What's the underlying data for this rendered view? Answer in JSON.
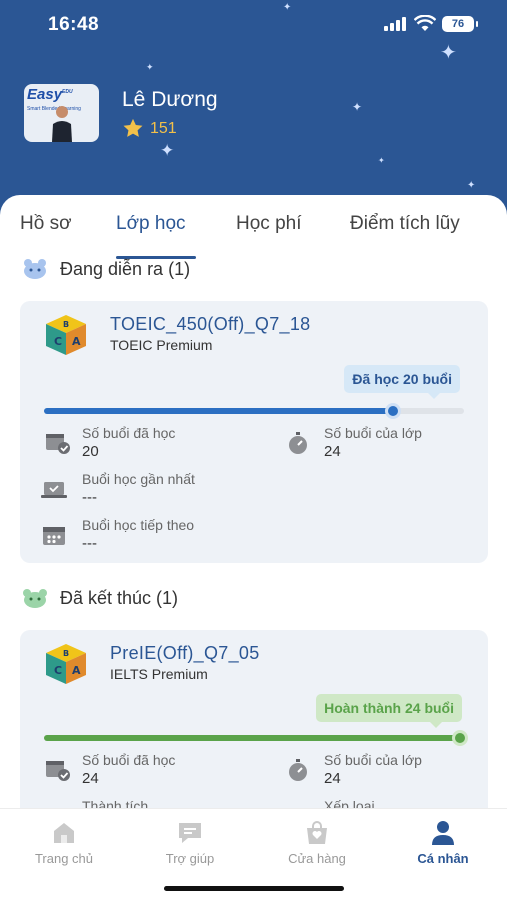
{
  "status_bar": {
    "time": "16:48",
    "battery": "76"
  },
  "profile": {
    "name": "Lê Dương",
    "points": "151",
    "avatar_logo": "Easy",
    "avatar_logo_sup": "EDU",
    "avatar_tagline": "Smart Blended Learning"
  },
  "tabs": [
    {
      "label": "Hồ sơ"
    },
    {
      "label": "Lớp học"
    },
    {
      "label": "Học phí"
    },
    {
      "label": "Điểm tích lũy"
    }
  ],
  "ongoing": {
    "title": "Đang diễn ra (1)",
    "course": {
      "name": "TOEIC_450(Off)_Q7_18",
      "type": "TOEIC Premium",
      "progress_label": "Đã học 20 buổi",
      "progress": 0.83,
      "stats": {
        "attended_label": "Số buổi đã học",
        "attended_value": "20",
        "total_label": "Số buổi của lớp",
        "total_value": "24",
        "last_label": "Buổi học gần nhất",
        "last_value": "---",
        "next_label": "Buổi học tiếp theo",
        "next_value": "---"
      }
    }
  },
  "finished": {
    "title": "Đã kết thúc (1)",
    "course": {
      "name": "PreIE(Off)_Q7_05",
      "type": "IELTS Premium",
      "progress_label": "Hoàn thành 24 buổi",
      "progress": 1.0,
      "stats": {
        "attended_label": "Số buổi đã học",
        "attended_value": "24",
        "total_label": "Số buổi của lớp",
        "total_value": "24",
        "achievement_label": "Thành tích",
        "rank_label": "Xếp loại"
      }
    }
  },
  "bottom_nav": [
    {
      "label": "Trang chủ"
    },
    {
      "label": "Trợ giúp"
    },
    {
      "label": "Cửa hàng"
    },
    {
      "label": "Cá nhân"
    }
  ],
  "colors": {
    "header": "#2b5694",
    "ongoing": "#2b6fc2",
    "finished": "#5aa34a",
    "star": "#f2c04a"
  }
}
